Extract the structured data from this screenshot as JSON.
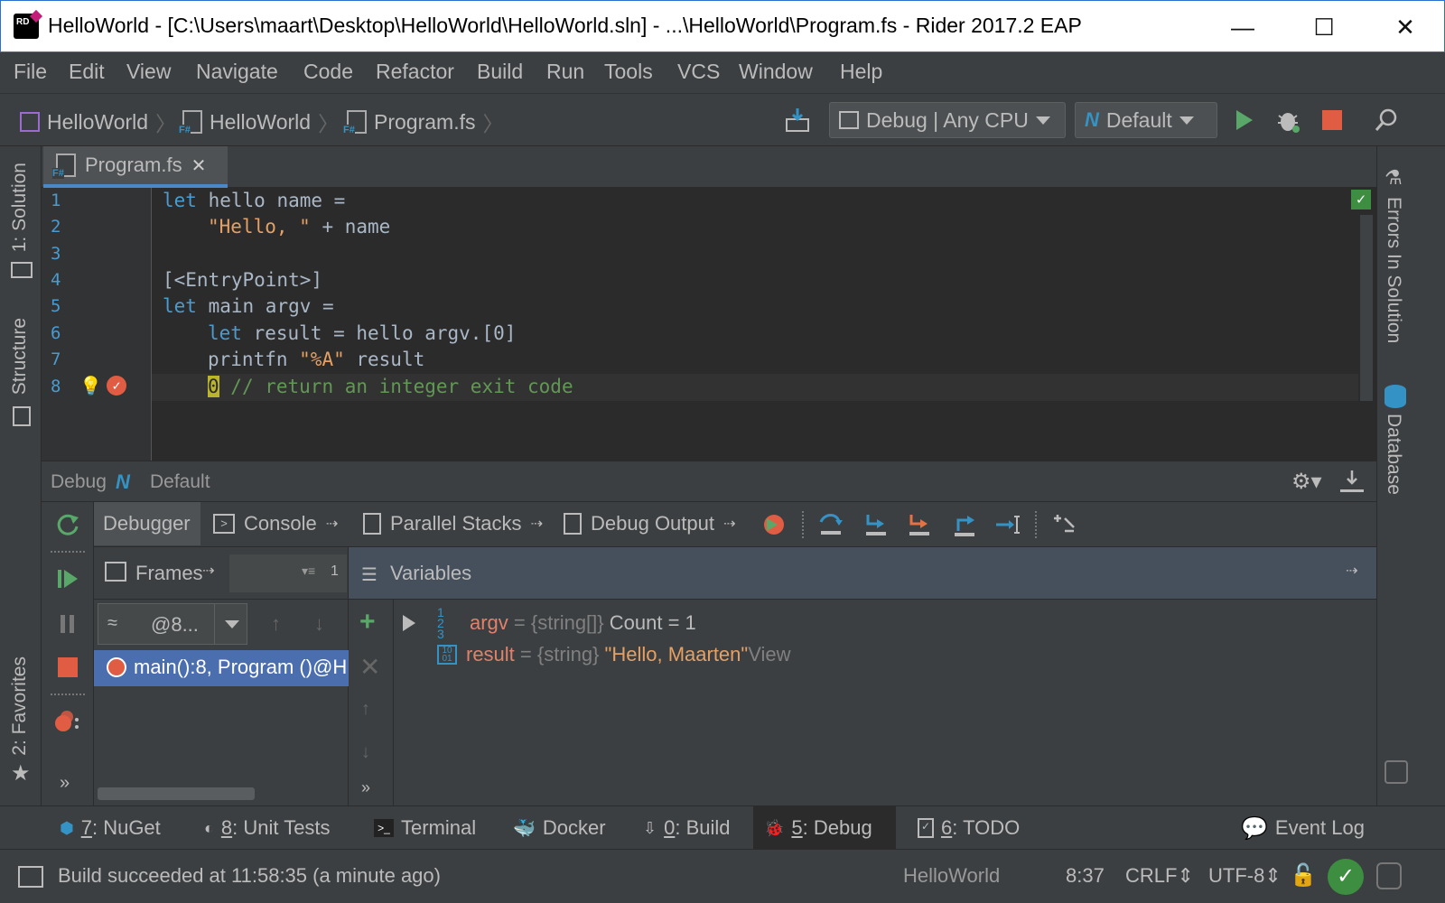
{
  "window": {
    "title": "HelloWorld - [C:\\Users\\maart\\Desktop\\HelloWorld\\HelloWorld.sln] - ...\\HelloWorld\\Program.fs - Rider 2017.2 EAP",
    "logo_text": "RD",
    "minimize": "—",
    "maximize": "☐",
    "close": "✕"
  },
  "menu": [
    "File",
    "Edit",
    "View",
    "Navigate",
    "Code",
    "Refactor",
    "Build",
    "Run",
    "Tools",
    "VCS",
    "Window",
    "Help"
  ],
  "breadcrumb": [
    "HelloWorld",
    "HelloWorld",
    "Program.fs"
  ],
  "run_config": {
    "config": "Debug | Any CPU",
    "target": "Default"
  },
  "left_tabs": {
    "solution": "1: Solution",
    "structure": "Structure",
    "favorites": "2: Favorites"
  },
  "right_tabs": {
    "errors": "Errors In Solution",
    "database": "Database"
  },
  "editor": {
    "tab_label": "Program.fs",
    "line_numbers": [
      "1",
      "2",
      "3",
      "4",
      "5",
      "6",
      "7",
      "8"
    ],
    "lines": {
      "l1_kw": "let",
      "l1_rest": " hello name =",
      "l2_str": "\"Hello, \"",
      "l2_rest": " + name",
      "l4": "[<EntryPoint>]",
      "l5_kw": "let",
      "l5_rest": " main argv =",
      "l6_kw": "let",
      "l6_rest": " result = hello argv.[0]",
      "l7_a": "printfn ",
      "l7_str": "\"%A\"",
      "l7_rest": " result",
      "l8_val": "0",
      "l8_comment": " // return an integer exit code"
    },
    "current_line": 8
  },
  "debug": {
    "title": "Debug",
    "config": "Default",
    "tabs": [
      "Debugger",
      "Console",
      "Parallel Stacks",
      "Debug Output"
    ],
    "frames_label": "Frames",
    "frames_count": "1",
    "thread": "@8...",
    "frame": "main():8, Program ()@H",
    "variables_label": "Variables",
    "variables": [
      {
        "name": "argv",
        "eq": "=",
        "type": "{string[]}",
        "value": "Count = 1",
        "expandable": true
      },
      {
        "name": "result",
        "eq": "=",
        "type": "{string}",
        "value": "\"Hello, Maarten\"",
        "link": "View",
        "expandable": false
      }
    ]
  },
  "bottom_tabs": [
    {
      "num": "7",
      "label": ": NuGet"
    },
    {
      "num": "8",
      "label": ": Unit Tests"
    },
    {
      "num": "",
      "label": "Terminal"
    },
    {
      "num": "",
      "label": "Docker"
    },
    {
      "num": "0",
      "label": ": Build"
    },
    {
      "num": "5",
      "label": ": Debug"
    },
    {
      "num": "6",
      "label": ": TODO"
    }
  ],
  "event_log": "Event Log",
  "status": {
    "message": "Build succeeded at 11:58:35 (a minute ago)",
    "project": "HelloWorld",
    "position": "8:37",
    "line_endings": "CRLF",
    "encoding": "UTF-8"
  },
  "colors": {
    "accent": "#4a88c7",
    "run_green": "#59a869",
    "stop_red": "#e05d44",
    "selection": "#4b6eaf"
  }
}
